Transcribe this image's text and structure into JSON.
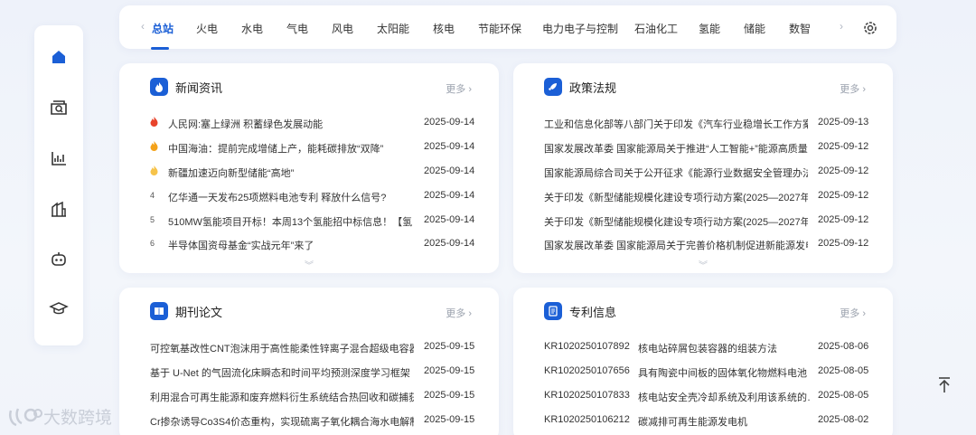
{
  "nav": {
    "tabs": [
      "总站",
      "火电",
      "水电",
      "气电",
      "风电",
      "太阳能",
      "核电",
      "节能环保",
      "电力电子与控制",
      "石油化工",
      "氢能",
      "储能",
      "数智"
    ],
    "prev_arrow": "‹",
    "next_arrow": "›"
  },
  "sidebar": {
    "icons": [
      "home-icon",
      "search-box-icon",
      "chart-icon",
      "building-icon",
      "robot-icon",
      "graduation-cap-icon"
    ]
  },
  "news": {
    "title": "新闻资讯",
    "more": "更多 ›",
    "items": [
      {
        "rank": "🔥",
        "text": "人民网:塞上绿洲 积蓄绿色发展动能",
        "date": "2025-09-14"
      },
      {
        "rank": "🔥",
        "text": "中国海油：提前完成增储上产，能耗碳排放“双降”",
        "date": "2025-09-14"
      },
      {
        "rank": "🔥",
        "text": "新疆加速迈向新型储能“高地”",
        "date": "2025-09-14"
      },
      {
        "rank": "4",
        "text": "亿华通一天发布25项燃料电池专利 释放什么信号?",
        "date": "2025-09-14"
      },
      {
        "rank": "5",
        "text": "510MW氢能项目开标！本周13个氢能招中标信息！【氢…",
        "date": "2025-09-14"
      },
      {
        "rank": "6",
        "text": "半导体国资母基金“实战元年”来了",
        "date": "2025-09-14"
      }
    ]
  },
  "policy": {
    "title": "政策法规",
    "more": "更多 ›",
    "items": [
      {
        "text": "工业和信息化部等八部门关于印发《汽车行业稳增长工作方案…",
        "date": "2025-09-13"
      },
      {
        "text": "国家发展改革委 国家能源局关于推进“人工智能+”能源高质量发…",
        "date": "2025-09-12"
      },
      {
        "text": "国家能源局综合司关于公开征求《能源行业数据安全管理办法…",
        "date": "2025-09-12"
      },
      {
        "text": "关于印发《新型储能规模化建设专项行动方案(2025—2027年)…",
        "date": "2025-09-12"
      },
      {
        "text": "关于印发《新型储能规模化建设专项行动方案(2025—2027年)…",
        "date": "2025-09-12"
      },
      {
        "text": "国家发展改革委 国家能源局关于完善价格机制促进新能源发电…",
        "date": "2025-09-12"
      }
    ]
  },
  "journal": {
    "title": "期刊论文",
    "more": "更多 ›",
    "items": [
      {
        "text": "可控氧基改性CNT泡沫用于高性能柔性锌离子混合超级电容器",
        "date": "2025-09-15"
      },
      {
        "text": "基于 U-Net 的气固流化床瞬态和时间平均预测深度学习框架",
        "date": "2025-09-15"
      },
      {
        "text": "利用混合可再生能源和废弃燃料衍生系统结合热回收和碳捕获…",
        "date": "2025-09-15"
      },
      {
        "text": "Cr掺杂诱导Co3S4价态重构，实现硫离子氧化耦合海水电解制氢",
        "date": "2025-09-15"
      }
    ]
  },
  "patent": {
    "title": "专利信息",
    "more": "更多 ›",
    "items": [
      {
        "no": "KR1020250107892",
        "text": "核电站碎屑包装容器的组装方法",
        "date": "2025-08-06"
      },
      {
        "no": "KR1020250107656",
        "text": "具有陶瓷中间板的固体氧化物燃料电池",
        "date": "2025-08-05"
      },
      {
        "no": "KR1020250107833",
        "text": "核电站安全壳冷却系统及利用该系统的…",
        "date": "2025-08-05"
      },
      {
        "no": "KR1020250106212",
        "text": "碳减排可再生能源发电机",
        "date": "2025-08-02"
      }
    ]
  },
  "watermark": "大数跨境",
  "colors": {
    "accent": "#1b5fd6",
    "fire_red": "#e8432b",
    "fire_orange": "#f4a21a"
  }
}
